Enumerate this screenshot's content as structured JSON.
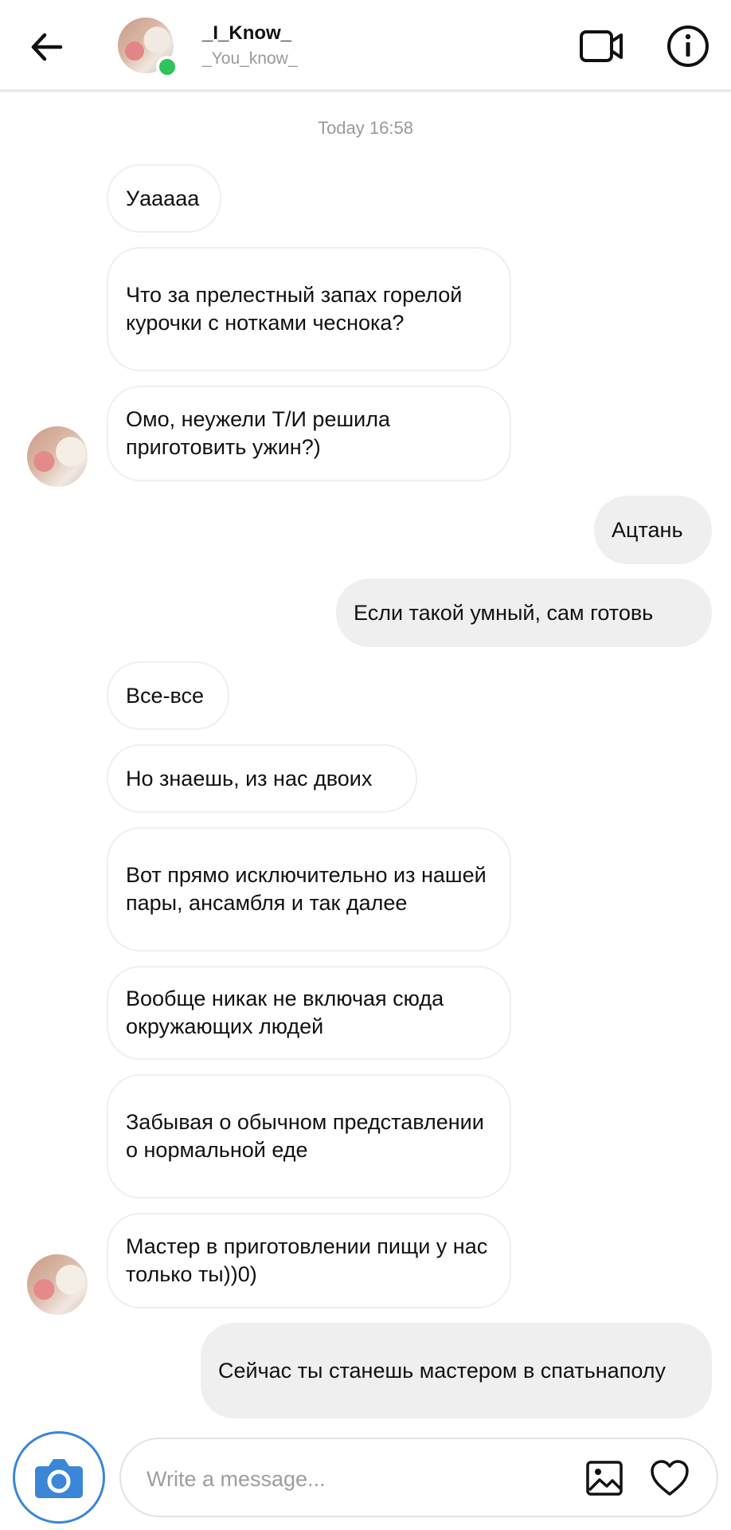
{
  "header": {
    "display_name": "_I_Know_",
    "username": "_You_know_",
    "icons": [
      "back-arrow-icon",
      "video-call-icon",
      "info-icon"
    ]
  },
  "timestamp": "Today 16:58",
  "messages": [
    {
      "side": "in",
      "text": "Уааааа"
    },
    {
      "side": "in",
      "text": "Что за прелестный запах горелой курочки с нотками чеснока?"
    },
    {
      "side": "in",
      "text": "Омо, неужели Т/И решила приготовить ужин?)"
    },
    {
      "side": "out",
      "text": "Ацтань"
    },
    {
      "side": "out",
      "text": "Если такой умный, сам готовь"
    },
    {
      "side": "in",
      "text": "Все-все"
    },
    {
      "side": "in",
      "text": "Но знаешь, из нас двоих"
    },
    {
      "side": "in",
      "text": "Вот прямо исключительно из нашей пары, ансамбля и так далее"
    },
    {
      "side": "in",
      "text": "Вообще никак не включая сюда окружающих людей"
    },
    {
      "side": "in",
      "text": "Забывая о обычном представлении о нормальной еде"
    },
    {
      "side": "in",
      "text": "Мастер в приготовлении пищи у нас только ты))0)"
    },
    {
      "side": "out",
      "text": "Сейчас ты станешь мастером в спатьнаполу"
    }
  ],
  "composer": {
    "placeholder": "Write a message...",
    "value": "",
    "icons": [
      "camera-icon",
      "gallery-icon",
      "heart-icon"
    ]
  },
  "colors": {
    "online": "#2fc35c",
    "camera_accent": "#3b86d6",
    "incoming_border": "#efefef",
    "outgoing_bg": "#efefef",
    "muted_text": "#9a9a9a"
  }
}
